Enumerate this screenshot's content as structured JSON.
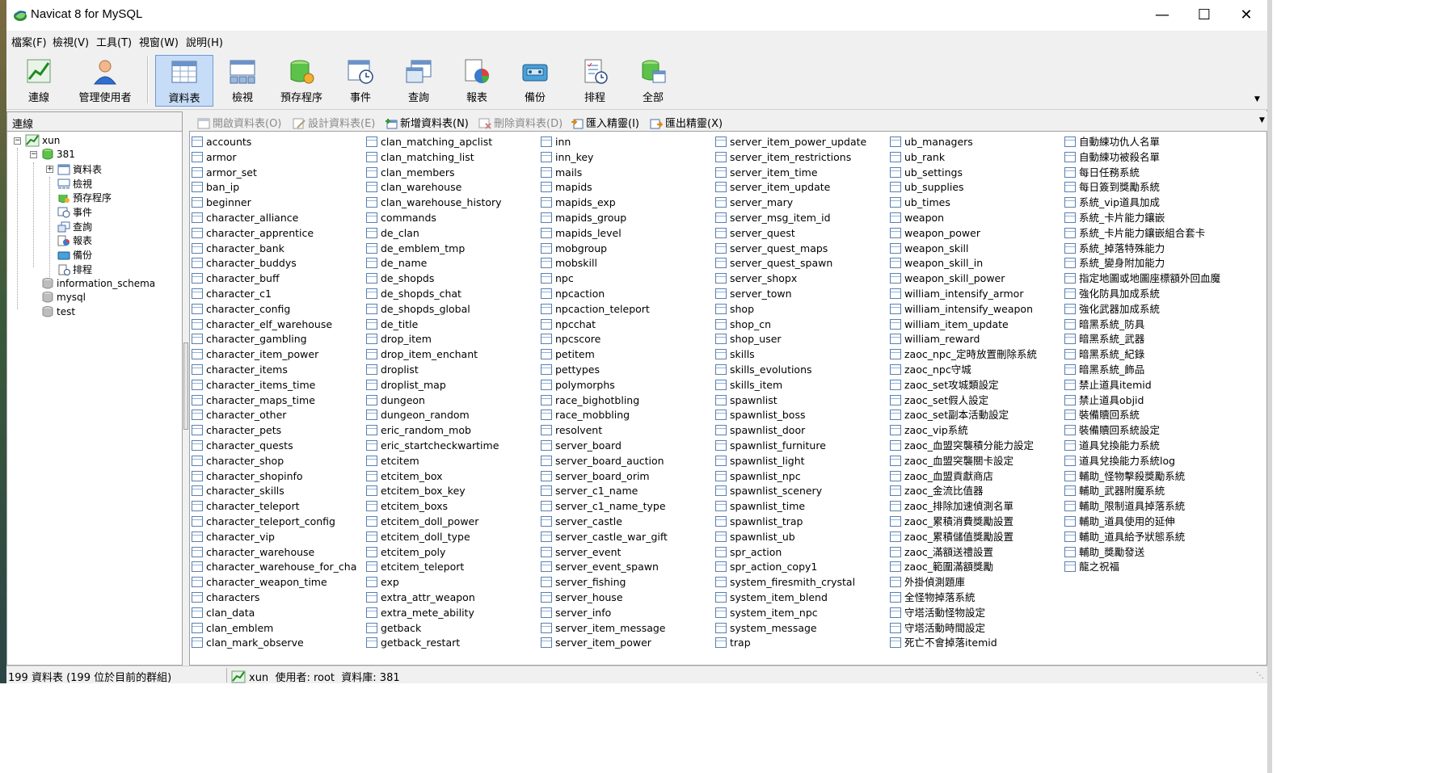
{
  "window": {
    "title": "Navicat 8 for MySQL"
  },
  "menu": [
    "檔案(F)",
    "檢視(V)",
    "工具(T)",
    "視窗(W)",
    "說明(H)"
  ],
  "toolbar": [
    {
      "label": "連線",
      "icon": "connection-icon"
    },
    {
      "label": "管理使用者",
      "icon": "user-icon"
    },
    {
      "label": "資料表",
      "icon": "table-icon",
      "active": true
    },
    {
      "label": "檢視",
      "icon": "view-icon"
    },
    {
      "label": "預存程序",
      "icon": "procedure-icon"
    },
    {
      "label": "事件",
      "icon": "event-icon"
    },
    {
      "label": "查詢",
      "icon": "query-icon"
    },
    {
      "label": "報表",
      "icon": "report-icon"
    },
    {
      "label": "備份",
      "icon": "backup-icon"
    },
    {
      "label": "排程",
      "icon": "schedule-icon"
    },
    {
      "label": "全部",
      "icon": "all-icon"
    }
  ],
  "connection_panel": {
    "header": "連線",
    "tree": {
      "connection": "xun",
      "database": "381",
      "children": [
        "資料表",
        "檢視",
        "預存程序",
        "事件",
        "查詢",
        "報表",
        "備份",
        "排程"
      ],
      "other_databases": [
        "information_schema",
        "mysql",
        "test"
      ]
    }
  },
  "object_toolbar": [
    {
      "label": "開啟資料表(O)",
      "enabled": false
    },
    {
      "label": "設計資料表(E)",
      "enabled": false
    },
    {
      "label": "新增資料表(N)",
      "enabled": true
    },
    {
      "label": "刪除資料表(D)",
      "enabled": false
    },
    {
      "label": "匯入精靈(I)",
      "enabled": true
    },
    {
      "label": "匯出精靈(X)",
      "enabled": true
    }
  ],
  "tables": [
    [
      "accounts",
      "armor",
      "armor_set",
      "ban_ip",
      "beginner",
      "character_alliance",
      "character_apprentice",
      "character_bank",
      "character_buddys",
      "character_buff",
      "character_c1",
      "character_config",
      "character_elf_warehouse",
      "character_gambling",
      "character_item_power",
      "character_items",
      "character_items_time",
      "character_maps_time",
      "character_other",
      "character_pets",
      "character_quests",
      "character_shop",
      "character_shopinfo",
      "character_skills",
      "character_teleport",
      "character_teleport_config",
      "character_vip",
      "character_warehouse",
      "character_warehouse_for_cha",
      "character_weapon_time",
      "characters",
      "clan_data",
      "clan_emblem",
      "clan_mark_observe"
    ],
    [
      "clan_matching_apclist",
      "clan_matching_list",
      "clan_members",
      "clan_warehouse",
      "clan_warehouse_history",
      "commands",
      "de_clan",
      "de_emblem_tmp",
      "de_name",
      "de_shopds",
      "de_shopds_chat",
      "de_shopds_global",
      "de_title",
      "drop_item",
      "drop_item_enchant",
      "droplist",
      "droplist_map",
      "dungeon",
      "dungeon_random",
      "eric_random_mob",
      "eric_startcheckwartime",
      "etcitem",
      "etcitem_box",
      "etcitem_box_key",
      "etcitem_boxs",
      "etcitem_doll_power",
      "etcitem_doll_type",
      "etcitem_poly",
      "etcitem_teleport",
      "exp",
      "extra_attr_weapon",
      "extra_mete_ability",
      "getback",
      "getback_restart"
    ],
    [
      "inn",
      "inn_key",
      "mails",
      "mapids",
      "mapids_exp",
      "mapids_group",
      "mapids_level",
      "mobgroup",
      "mobskill",
      "npc",
      "npcaction",
      "npcaction_teleport",
      "npcchat",
      "npcscore",
      "petitem",
      "pettypes",
      "polymorphs",
      "race_bighotbling",
      "race_mobbling",
      "resolvent",
      "server_board",
      "server_board_auction",
      "server_board_orim",
      "server_c1_name",
      "server_c1_name_type",
      "server_castle",
      "server_castle_war_gift",
      "server_event",
      "server_event_spawn",
      "server_fishing",
      "server_house",
      "server_info",
      "server_item_message",
      "server_item_power"
    ],
    [
      "server_item_power_update",
      "server_item_restrictions",
      "server_item_time",
      "server_item_update",
      "server_mary",
      "server_msg_item_id",
      "server_quest",
      "server_quest_maps",
      "server_quest_spawn",
      "server_shopx",
      "server_town",
      "shop",
      "shop_cn",
      "shop_user",
      "skills",
      "skills_evolutions",
      "skills_item",
      "spawnlist",
      "spawnlist_boss",
      "spawnlist_door",
      "spawnlist_furniture",
      "spawnlist_light",
      "spawnlist_npc",
      "spawnlist_scenery",
      "spawnlist_time",
      "spawnlist_trap",
      "spawnlist_ub",
      "spr_action",
      "spr_action_copy1",
      "system_firesmith_crystal",
      "system_item_blend",
      "system_item_npc",
      "system_message",
      "trap"
    ],
    [
      "ub_managers",
      "ub_rank",
      "ub_settings",
      "ub_supplies",
      "ub_times",
      "weapon",
      "weapon_power",
      "weapon_skill",
      "weapon_skill_in",
      "weapon_skill_power",
      "william_intensify_armor",
      "william_intensify_weapon",
      "william_item_update",
      "william_reward",
      "zaoc_npc_定時放置刪除系統",
      "zaoc_npc守城",
      "zaoc_set攻城類設定",
      "zaoc_set假人設定",
      "zaoc_set副本活動設定",
      "zaoc_vip系統",
      "zaoc_血盟突襲積分能力設定",
      "zaoc_血盟突襲關卡設定",
      "zaoc_血盟貢獻商店",
      "zaoc_金流比值器",
      "zaoc_排除加速偵測名單",
      "zaoc_累積消費獎勵設置",
      "zaoc_累積儲值獎勵設置",
      "zaoc_滿額送禮設置",
      "zaoc_範圍滿額獎勵",
      "外掛偵測題庫",
      "全怪物掉落系統",
      "守塔活動怪物設定",
      "守塔活動時間設定",
      "死亡不會掉落itemid"
    ],
    [
      "自動練功仇人名單",
      "自動練功被殺名單",
      "每日任務系統",
      "每日簽到獎勵系統",
      "系統_vip道具加成",
      "系統_卡片能力鑲嵌",
      "系統_卡片能力鑲嵌組合套卡",
      "系統_掉落特殊能力",
      "系統_變身附加能力",
      "指定地圖或地圖座標額外回血魔",
      "強化防具加成系統",
      "強化武器加成系統",
      "暗黑系統_防具",
      "暗黑系統_武器",
      "暗黑系統_紀錄",
      "暗黑系統_飾品",
      "禁止道具itemid",
      "禁止道具objid",
      "裝備贖回系統",
      "裝備贖回系統設定",
      "道具兌換能力系統",
      "道具兌換能力系統log",
      "輔助_怪物擊殺獎勵系統",
      "輔助_武器附魔系統",
      "輔助_限制道具掉落系統",
      "輔助_道具使用的延伸",
      "輔助_道具給予狀態系統",
      "輔助_獎勵發送",
      "龍之祝福"
    ]
  ],
  "status": {
    "left": "199 資料表 (199 位於目前的群組)",
    "connection": "xun",
    "user_label": "使用者: root",
    "db_label": "資料庫: 381"
  },
  "colors": {
    "active_toolbar_bg": "#c6dcf7",
    "active_toolbar_border": "#6e9ad6",
    "chrome": "#f0f0f0"
  }
}
